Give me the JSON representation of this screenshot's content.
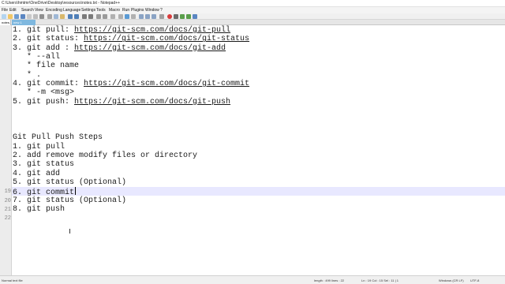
{
  "window": {
    "title": "C:\\Users\\hmtmr\\OneDrive\\Desktop\\resources\\notes.txt - Notepad++"
  },
  "menu": [
    "File",
    "Edit",
    "Search",
    "View",
    "Encoding",
    "Language",
    "Settings",
    "Tools",
    "Macro",
    "Run",
    "Plugins",
    "Window",
    "?"
  ],
  "tabs": [
    {
      "label": "notes.txt"
    },
    {
      "label": "new 1"
    }
  ],
  "editor": {
    "gutter": [
      "",
      "",
      "",
      "",
      "",
      "",
      "",
      "",
      "",
      "",
      "",
      "",
      "",
      "",
      "",
      "",
      "",
      "",
      "19",
      "20",
      "21",
      "22"
    ],
    "current_line_index": 18,
    "lines": [
      {
        "text": "1. git pull: ",
        "link": "https://git-scm.com/docs/git-pull"
      },
      {
        "text": "2. git status: ",
        "link": "https://git-scm.com/docs/git-status"
      },
      {
        "text": "3. git add : ",
        "link": "https://git-scm.com/docs/git-add"
      },
      {
        "text": "   * --all"
      },
      {
        "text": "   * file name"
      },
      {
        "text": "   * ."
      },
      {
        "text": "4. git commit: ",
        "link": "https://git-scm.com/docs/git-commit"
      },
      {
        "text": "   * -m <msg>"
      },
      {
        "text": "5. git push: ",
        "link": "https://git-scm.com/docs/git-push"
      },
      {
        "text": ""
      },
      {
        "text": ""
      },
      {
        "text": ""
      },
      {
        "text": "Git Pull Push Steps"
      },
      {
        "text": "1. git pull"
      },
      {
        "text": "2. add remove modify files or directory"
      },
      {
        "text": "3. git status"
      },
      {
        "text": "4. git add"
      },
      {
        "text": "5. git status (Optional)"
      },
      {
        "text": "6. git commit"
      },
      {
        "text": "7. git status (Optional)"
      },
      {
        "text": "8. git push"
      },
      {
        "text": ""
      }
    ]
  },
  "status": {
    "filetype": "Normal text file",
    "length": "length : 499    lines : 22",
    "position": "Ln : 19    Col : 15    Sel : 11 | 1",
    "eol": "Windows (CR LF)",
    "encoding": "UTF-8"
  }
}
